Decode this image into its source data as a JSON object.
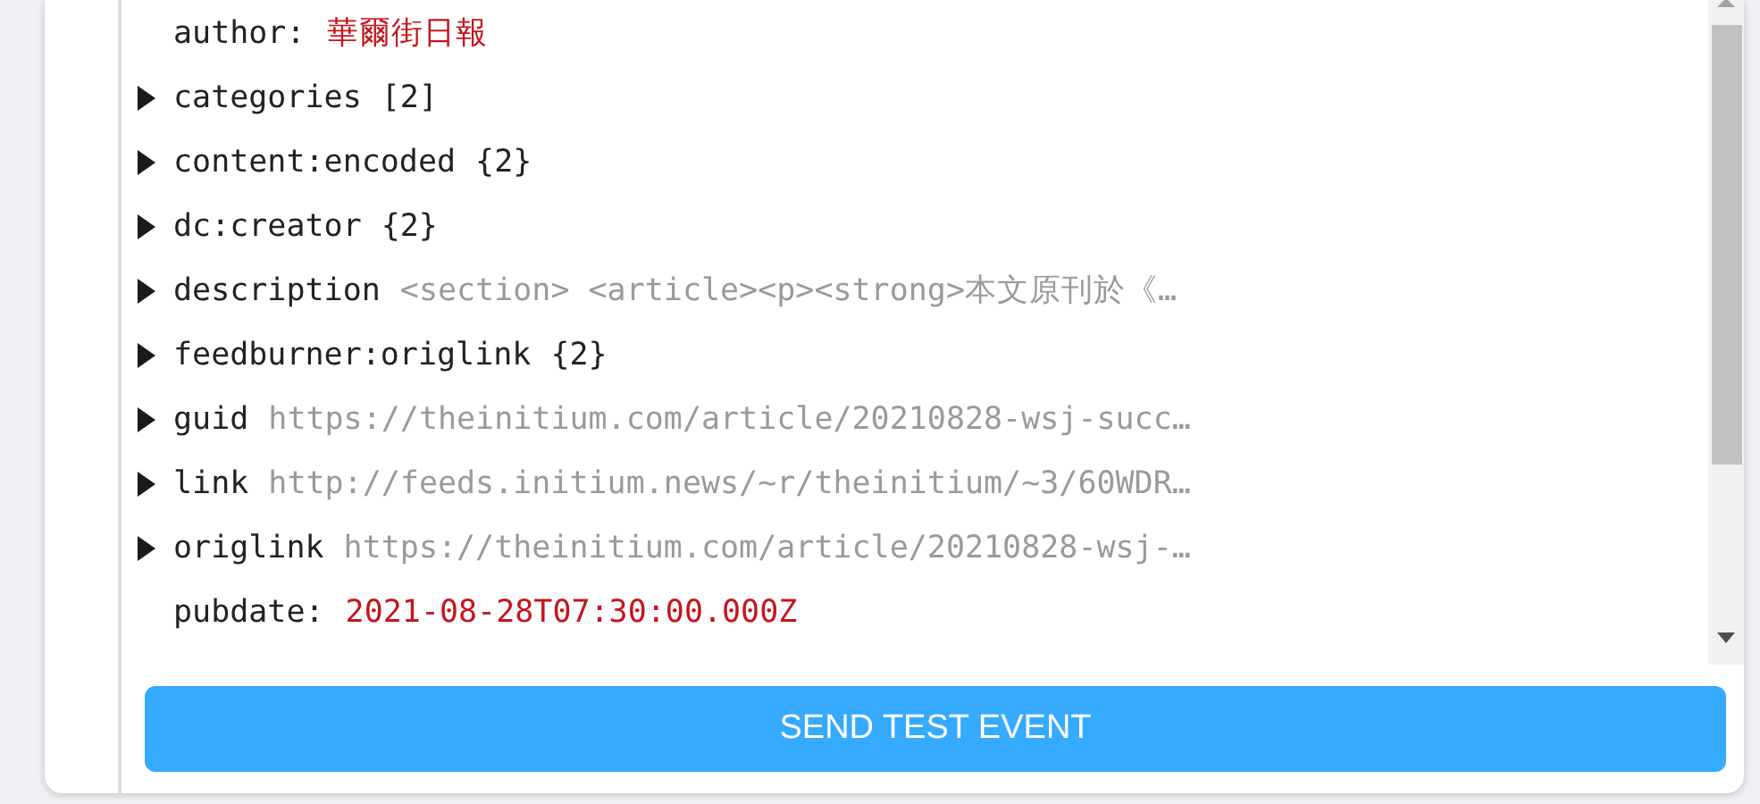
{
  "tree": [
    {
      "kind": "value",
      "key": "author:",
      "value": "華爾街日報"
    },
    {
      "kind": "node",
      "key": "categories",
      "summary": "[2]",
      "preview": false,
      "expanded": false
    },
    {
      "kind": "node",
      "key": "content:encoded",
      "summary": "{2}",
      "preview": false,
      "expanded": false
    },
    {
      "kind": "node",
      "key": "dc:creator",
      "summary": "{2}",
      "preview": false,
      "expanded": false
    },
    {
      "kind": "node",
      "key": "description",
      "summary": "<section> <article><p><strong>本文原刊於《…",
      "preview": true,
      "expanded": false
    },
    {
      "kind": "node",
      "key": "feedburner:origlink",
      "summary": "{2}",
      "preview": false,
      "expanded": false
    },
    {
      "kind": "node",
      "key": "guid",
      "summary": "https://theinitium.com/article/20210828-wsj-succ…",
      "preview": true,
      "expanded": false
    },
    {
      "kind": "node",
      "key": "link",
      "summary": "http://feeds.initium.news/~r/theinitium/~3/60WDR…",
      "preview": true,
      "expanded": false
    },
    {
      "kind": "node",
      "key": "origlink",
      "summary": "https://theinitium.com/article/20210828-wsj-…",
      "preview": true,
      "expanded": false
    },
    {
      "kind": "value",
      "key": "pubdate:",
      "value": "2021-08-28T07:30:00.000Z"
    }
  ],
  "button": {
    "label": "SEND TEST EVENT"
  }
}
